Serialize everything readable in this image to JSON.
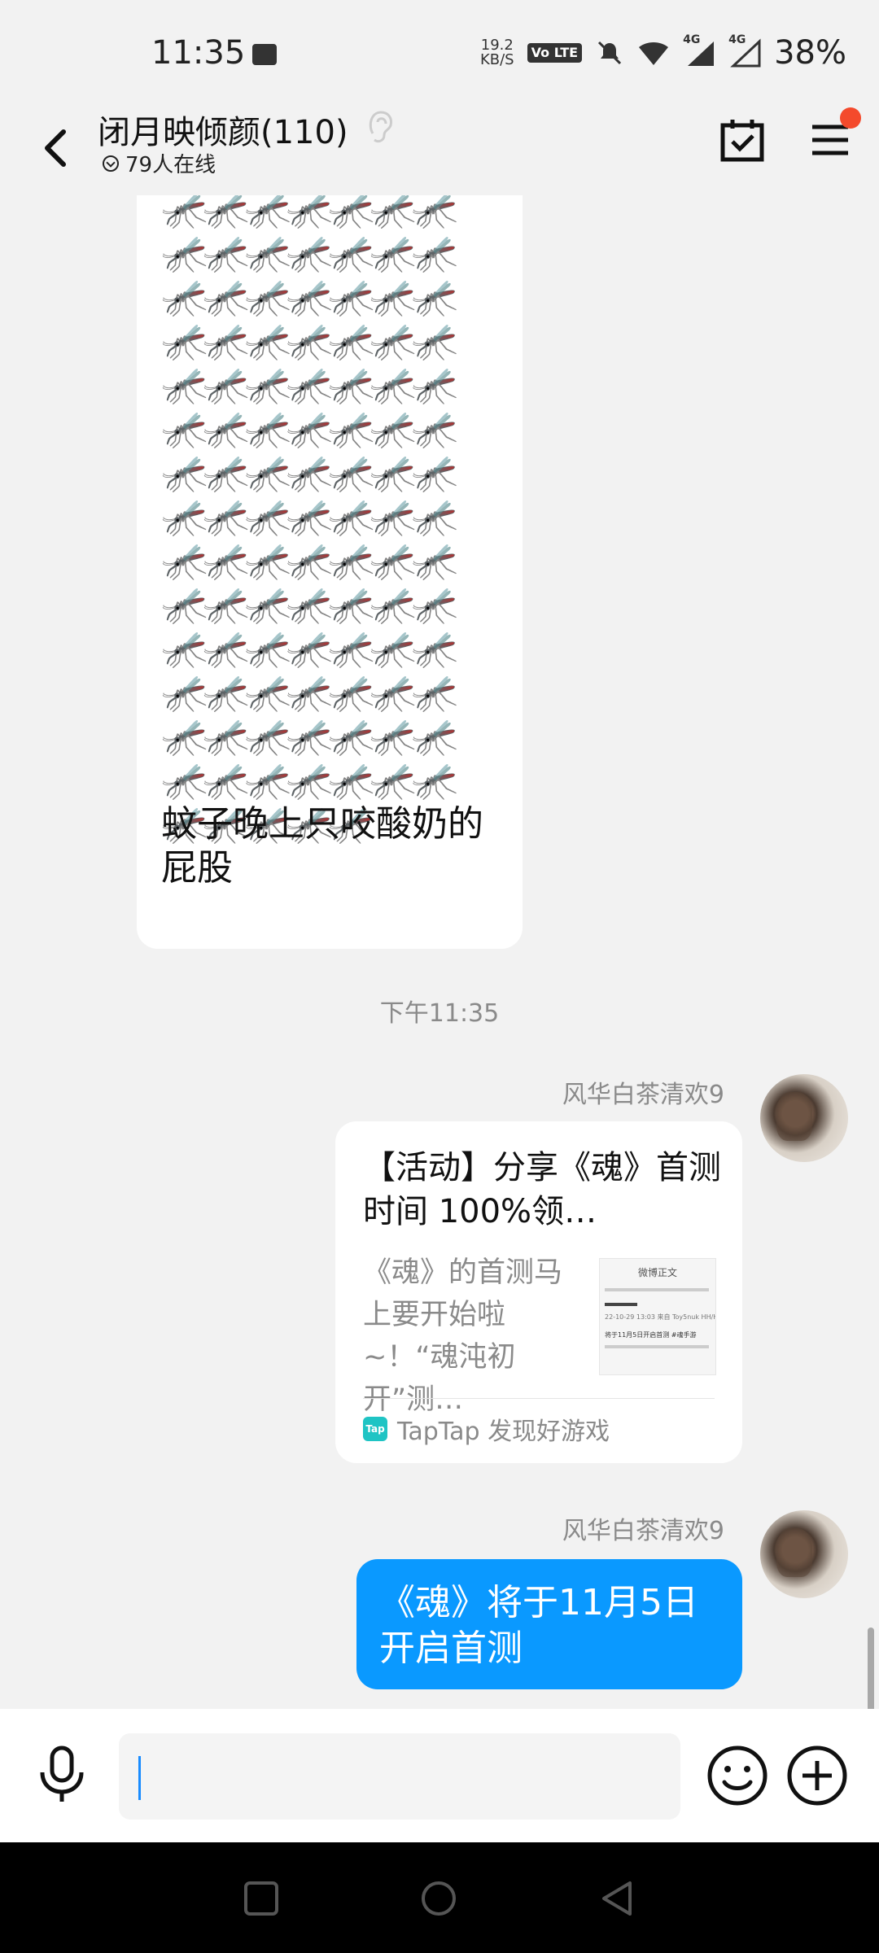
{
  "status_bar": {
    "time": "11:35",
    "net_speed_value": "19.2",
    "net_speed_unit": "KB/S",
    "volte": "Vo LTE",
    "sig1": "4G",
    "sig2": "4G",
    "battery": "38%"
  },
  "header": {
    "title": "闭月映倾颜(110)",
    "online": "79人在线"
  },
  "messages": {
    "mosquito_rows": [
      "🦟🦟🦟🦟🦟🦟🦟",
      "🦟🦟🦟🦟🦟🦟🦟",
      "🦟🦟🦟🦟🦟🦟🦟",
      "🦟🦟🦟🦟🦟🦟🦟",
      "🦟🦟🦟🦟🦟🦟🦟",
      "🦟🦟🦟🦟🦟🦟🦟",
      "🦟🦟🦟🦟🦟🦟🦟",
      "🦟🦟🦟🦟🦟🦟🦟",
      "🦟🦟🦟🦟🦟🦟🦟",
      "🦟🦟🦟🦟🦟🦟🦟",
      "🦟🦟🦟🦟🦟🦟🦟",
      "🦟🦟🦟🦟🦟🦟🦟",
      "🦟🦟🦟🦟🦟🦟🦟",
      "🦟🦟🦟🦟🦟🦟🦟",
      "🦟🦟🦟🦟🦟"
    ],
    "left_text": "蚊子晚上只咬酸奶的屁股",
    "timestamp": "下午11:35",
    "sender1": "风华白茶清欢9",
    "card": {
      "title": "【活动】分享《魂》首测时间 100%领…",
      "desc": "《魂》的首测马上要开始啦~！“魂沌初开”测…",
      "thumb_header": "微博正文",
      "thumb_line1": "22-10-29 13:03 来自 Toy5nuk HH/HH日",
      "thumb_line2": "将于11月5日开启首测 #魂手游",
      "source": "TapTap 发现好游戏",
      "source_logo": "Tap"
    },
    "sender2": "风华白茶清欢9",
    "blue_text": "《魂》将于11月5日开启首测"
  },
  "input_bar": {
    "value": ""
  },
  "colors": {
    "accent": "#0a99ff",
    "badge": "#f44a2c"
  },
  "icons": [
    "back-icon",
    "ear-icon",
    "calendar-check-icon",
    "menu-icon",
    "mic-icon",
    "emoji-icon",
    "plus-icon"
  ]
}
